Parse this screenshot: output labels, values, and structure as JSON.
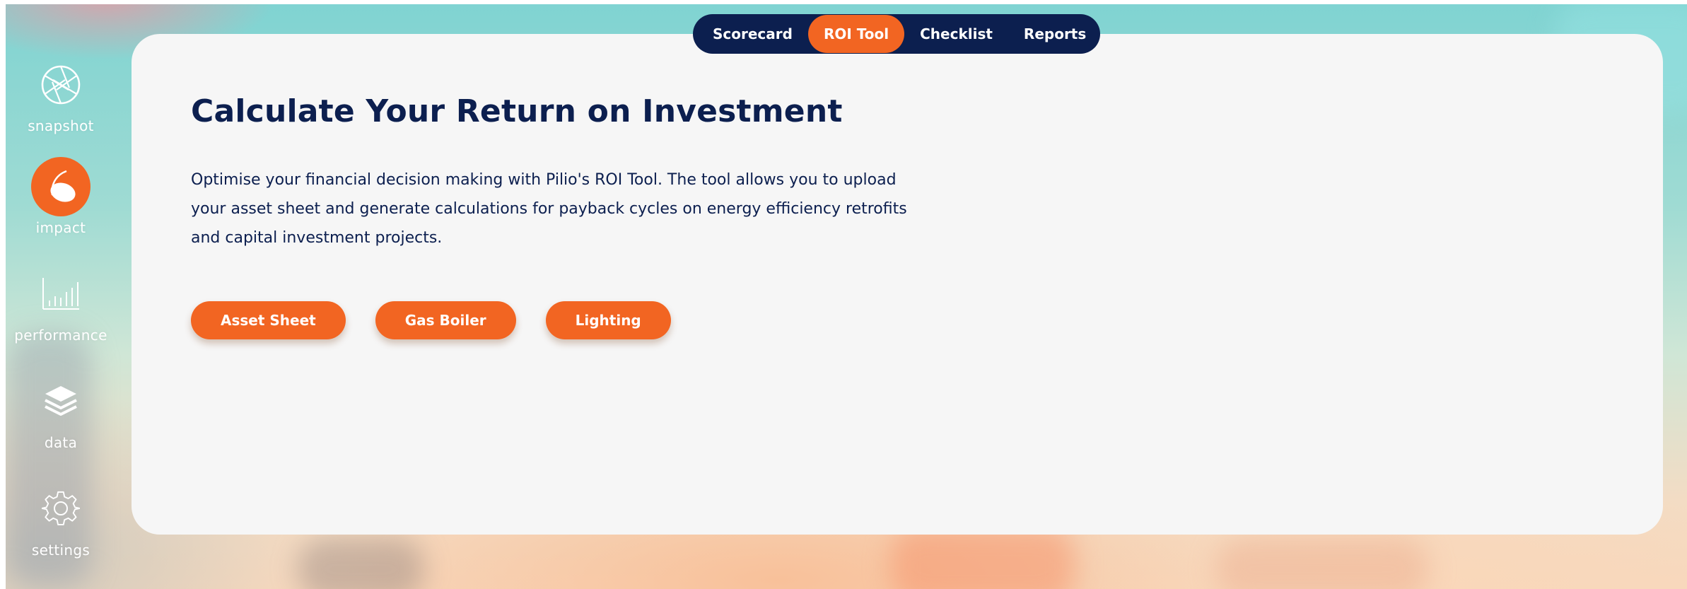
{
  "colors": {
    "navy": "#0c1f4f",
    "accent_orange": "#f26522",
    "card_background": "#f6f6f6"
  },
  "sidebar": {
    "items": [
      {
        "label": "snapshot",
        "icon": "aperture-icon",
        "active": false
      },
      {
        "label": "impact",
        "icon": "impact-icon",
        "active": true
      },
      {
        "label": "performance",
        "icon": "bar-chart-icon",
        "active": false
      },
      {
        "label": "data",
        "icon": "layers-icon",
        "active": false
      },
      {
        "label": "settings",
        "icon": "gear-icon",
        "active": false
      }
    ]
  },
  "tabs": [
    {
      "label": "Scorecard",
      "active": false
    },
    {
      "label": "ROI Tool",
      "active": true
    },
    {
      "label": "Checklist",
      "active": false
    },
    {
      "label": "Reports",
      "active": false
    }
  ],
  "main": {
    "title": "Calculate Your Return on Investment",
    "description": "Optimise your financial decision making with Pilio's ROI Tool. The tool allows you to upload your asset sheet and generate calculations for payback cycles on energy efficiency retrofits and capital investment projects.",
    "buttons": [
      {
        "label": "Asset Sheet"
      },
      {
        "label": "Gas Boiler"
      },
      {
        "label": "Lighting"
      }
    ]
  }
}
